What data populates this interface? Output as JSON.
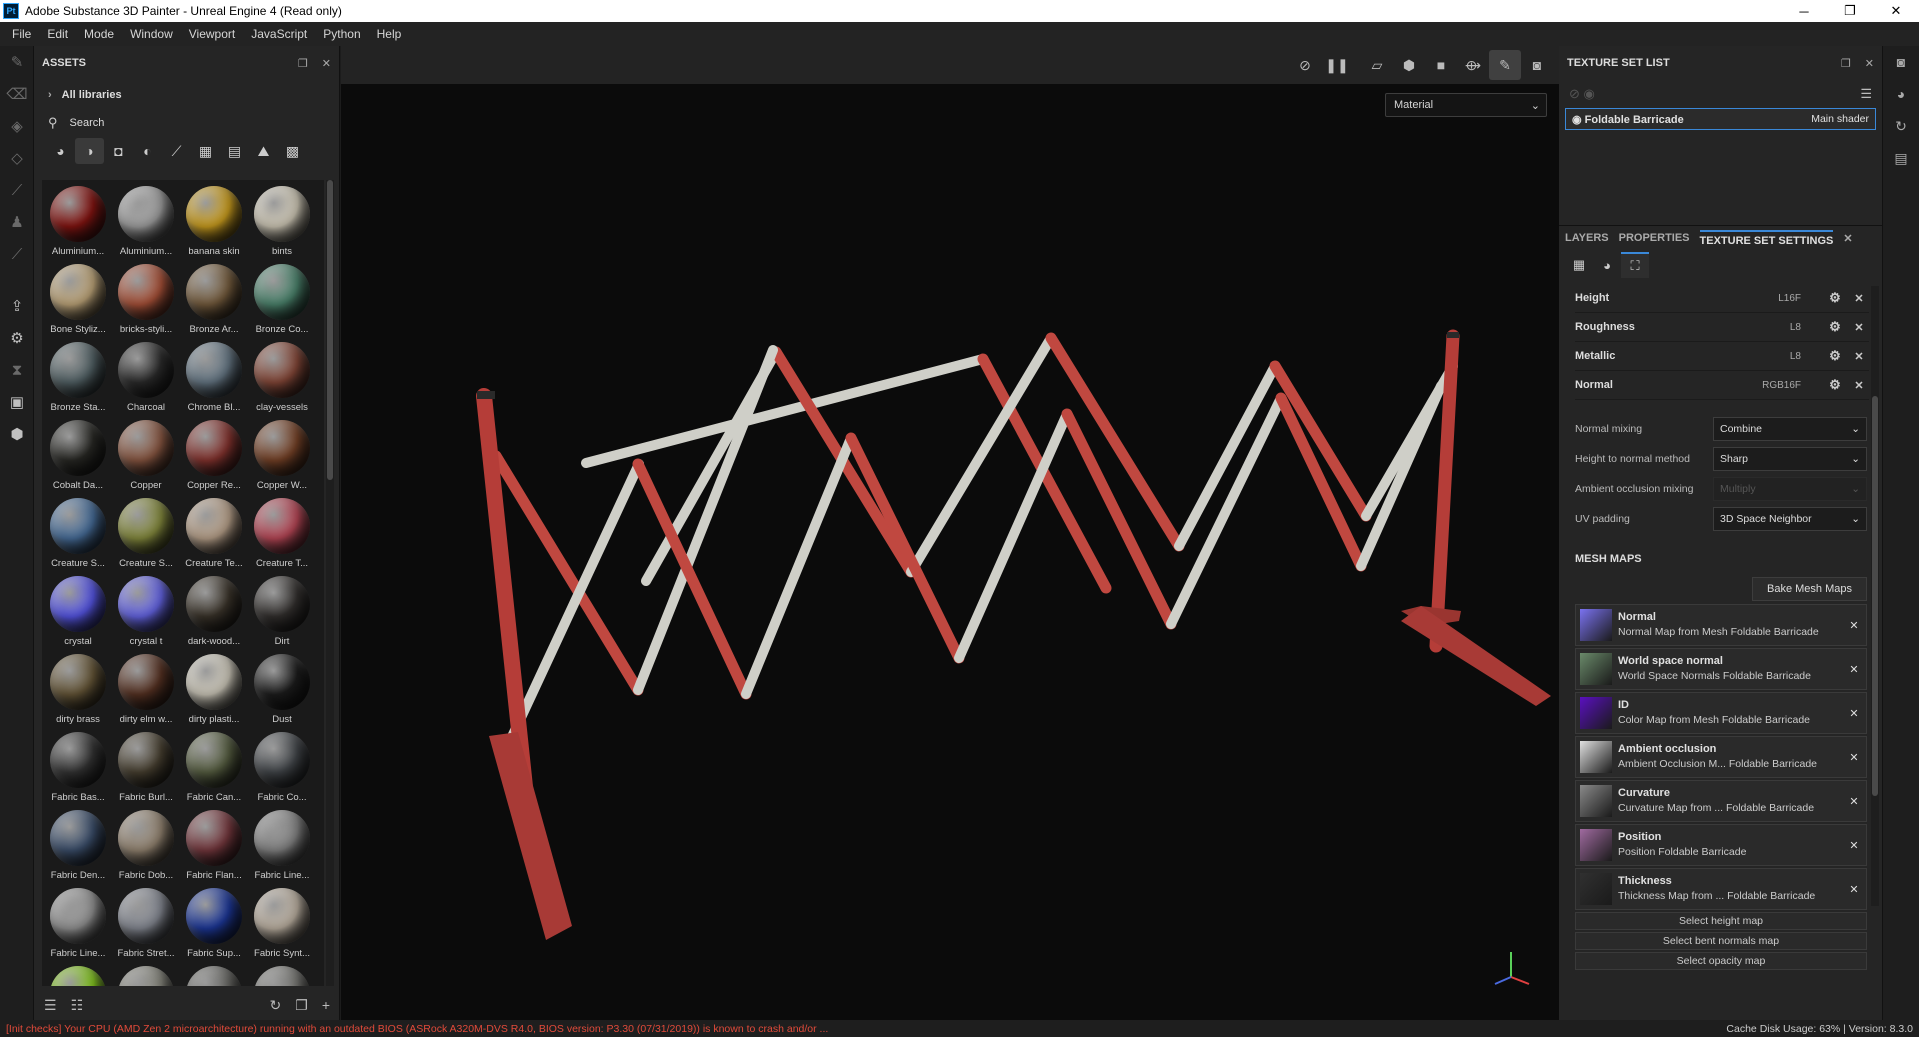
{
  "window": {
    "title": "Adobe Substance 3D Painter - Unreal Engine 4 (Read only)",
    "app_badge": "Pt",
    "controls": [
      "─",
      "❐",
      "✕"
    ]
  },
  "menu": [
    "File",
    "Edit",
    "Mode",
    "Window",
    "Viewport",
    "JavaScript",
    "Python",
    "Help"
  ],
  "assets": {
    "title": "ASSETS",
    "library": "All libraries",
    "search_placeholder": "Search",
    "materials": [
      {
        "name": "Aluminium...",
        "color": "#8a1512"
      },
      {
        "name": "Aluminium...",
        "color": "#a8a8a8"
      },
      {
        "name": "banana skin",
        "color": "#d4a520"
      },
      {
        "name": "bints",
        "color": "#d9d2bf"
      },
      {
        "name": "Bone Styliz...",
        "color": "#c7ad7f"
      },
      {
        "name": "bricks-styli...",
        "color": "#b0553b"
      },
      {
        "name": "Bronze Ar...",
        "color": "#7a6040"
      },
      {
        "name": "Bronze Co...",
        "color": "#4f8a72"
      },
      {
        "name": "Bronze Sta...",
        "color": "#56666a"
      },
      {
        "name": "Charcoal",
        "color": "#2d2d2d"
      },
      {
        "name": "Chrome Bl...",
        "color": "#6a7c8a"
      },
      {
        "name": "clay-vessels",
        "color": "#8a4a3a"
      },
      {
        "name": "Cobalt Da...",
        "color": "#2a2a26"
      },
      {
        "name": "Copper",
        "color": "#8e5a44"
      },
      {
        "name": "Copper Re...",
        "color": "#8a3530"
      },
      {
        "name": "Copper W...",
        "color": "#7a4428"
      },
      {
        "name": "Creature S...",
        "color": "#4a72a0"
      },
      {
        "name": "Creature S...",
        "color": "#8a9040"
      },
      {
        "name": "Creature Te...",
        "color": "#c0a890"
      },
      {
        "name": "Creature T...",
        "color": "#c04a5a"
      },
      {
        "name": "crystal",
        "color": "#5a5af0"
      },
      {
        "name": "crystal t",
        "color": "#6a6af0"
      },
      {
        "name": "dark-wood...",
        "color": "#3d362c"
      },
      {
        "name": "Dirt",
        "color": "#353230"
      },
      {
        "name": "dirty brass",
        "color": "#6a5a3a"
      },
      {
        "name": "dirty elm w...",
        "color": "#5a3424"
      },
      {
        "name": "dirty plasti...",
        "color": "#d6d1c2"
      },
      {
        "name": "Dust",
        "color": "#1e1e1e"
      },
      {
        "name": "Fabric Bas...",
        "color": "#363636"
      },
      {
        "name": "Fabric Burl...",
        "color": "#4a4232"
      },
      {
        "name": "Fabric Can...",
        "color": "#5a6244"
      },
      {
        "name": "Fabric Co...",
        "color": "#44484c"
      },
      {
        "name": "Fabric Den...",
        "color": "#3e5270"
      },
      {
        "name": "Fabric Dob...",
        "color": "#9a8a76"
      },
      {
        "name": "Fabric Flan...",
        "color": "#7a3a40"
      },
      {
        "name": "Fabric Line...",
        "color": "#8a8a8a"
      },
      {
        "name": "Fabric Line...",
        "color": "#9a9a9a"
      },
      {
        "name": "Fabric Stret...",
        "color": "#8a8e98"
      },
      {
        "name": "Fabric Sup...",
        "color": "#1e3aa0"
      },
      {
        "name": "Fabric Synt...",
        "color": "#c4b8a8"
      },
      {
        "name": "",
        "color": "#8ad020"
      },
      {
        "name": "",
        "color": "#8a8a80"
      },
      {
        "name": "",
        "color": "#6a6a66"
      },
      {
        "name": "",
        "color": "#7a7a76"
      }
    ]
  },
  "viewport": {
    "channel": "Material"
  },
  "texture_set_list": {
    "title": "TEXTURE SET LIST",
    "set_name": "Foldable Barricade",
    "shader": "Main shader"
  },
  "properties": {
    "tabs": [
      "LAYERS",
      "PROPERTIES",
      "TEXTURE SET SETTINGS"
    ],
    "channels": [
      {
        "name": "Height",
        "format": "L16F"
      },
      {
        "name": "Roughness",
        "format": "L8"
      },
      {
        "name": "Metallic",
        "format": "L8"
      },
      {
        "name": "Normal",
        "format": "RGB16F"
      }
    ],
    "options": [
      {
        "label": "Normal mixing",
        "value": "Combine",
        "disabled": false
      },
      {
        "label": "Height to normal method",
        "value": "Sharp",
        "disabled": false
      },
      {
        "label": "Ambient occlusion mixing",
        "value": "Multiply",
        "disabled": true
      },
      {
        "label": "UV padding",
        "value": "3D Space Neighbor",
        "disabled": false
      }
    ],
    "mesh_maps_title": "MESH MAPS",
    "bake_button": "Bake Mesh Maps",
    "mesh_maps": [
      {
        "name": "Normal",
        "desc": "Normal Map from Mesh Foldable Barricade",
        "thumb": "#7a72f0"
      },
      {
        "name": "World space normal",
        "desc": "World Space Normals Foldable Barricade",
        "thumb": "#6a8a6a"
      },
      {
        "name": "ID",
        "desc": "Color Map from Mesh Foldable Barricade",
        "thumb": "#5a10c0"
      },
      {
        "name": "Ambient occlusion",
        "desc": "Ambient Occlusion M... Foldable Barricade",
        "thumb": "#e0e0e0"
      },
      {
        "name": "Curvature",
        "desc": "Curvature Map from ... Foldable Barricade",
        "thumb": "#8a8a8a"
      },
      {
        "name": "Position",
        "desc": "Position Foldable Barricade",
        "thumb": "#a06aa0"
      },
      {
        "name": "Thickness",
        "desc": "Thickness Map from ... Foldable Barricade",
        "thumb": "#303030"
      }
    ],
    "select_buttons": [
      "Select height map",
      "Select bent normals map",
      "Select opacity map"
    ]
  },
  "status": {
    "error": "[Init checks] Your CPU (AMD Zen 2 microarchitecture) running with an outdated BIOS (ASRock A320M-DVS R4.0, BIOS version: P3.30 (07/31/2019)) is known to crash and/or ...",
    "cache": "Cache Disk Usage:   63% | Version: 8.3.0"
  }
}
